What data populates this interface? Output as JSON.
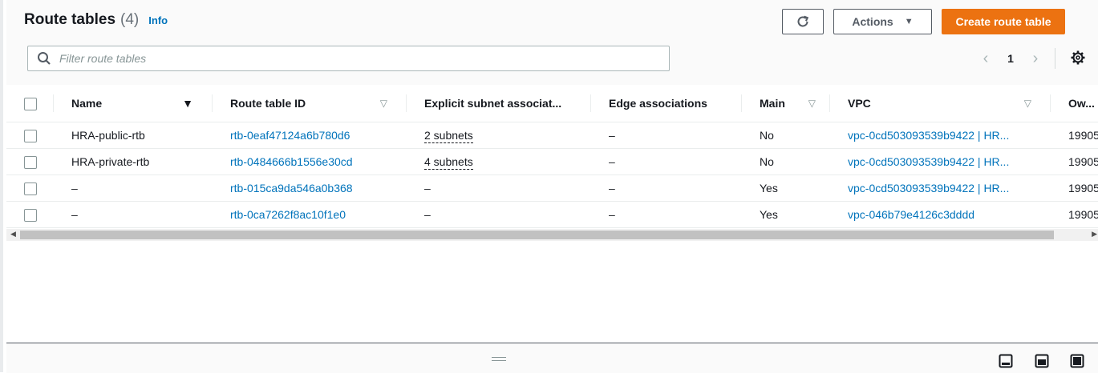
{
  "header": {
    "title": "Route tables",
    "count": "(4)",
    "info": "Info"
  },
  "buttons": {
    "actions": "Actions",
    "create": "Create route table"
  },
  "filter": {
    "placeholder": "Filter route tables"
  },
  "pagination": {
    "page": "1"
  },
  "table": {
    "columns": [
      "Name",
      "Route table ID",
      "Explicit subnet associat...",
      "Edge associations",
      "Main",
      "VPC",
      "Ow..."
    ],
    "rows": [
      {
        "name": "HRA-public-rtb",
        "id": "rtb-0eaf47124a6b780d6",
        "subnets": "2 subnets",
        "edge": "–",
        "main": "No",
        "vpc": "vpc-0cd503093539b9422 | HR...",
        "owner": "19905"
      },
      {
        "name": "HRA-private-rtb",
        "id": "rtb-0484666b1556e30cd",
        "subnets": "4 subnets",
        "edge": "–",
        "main": "No",
        "vpc": "vpc-0cd503093539b9422 | HR...",
        "owner": "19905"
      },
      {
        "name": "–",
        "id": "rtb-015ca9da546a0b368",
        "subnets": "–",
        "edge": "–",
        "main": "Yes",
        "vpc": "vpc-0cd503093539b9422 | HR...",
        "owner": "19905"
      },
      {
        "name": "–",
        "id": "rtb-0ca7262f8ac10f1e0",
        "subnets": "–",
        "edge": "–",
        "main": "Yes",
        "vpc": "vpc-046b79e4126c3dddd",
        "owner": "19905"
      }
    ]
  },
  "colors": {
    "primary": "#ec7211",
    "link": "#0073bb",
    "text": "#16191f"
  }
}
